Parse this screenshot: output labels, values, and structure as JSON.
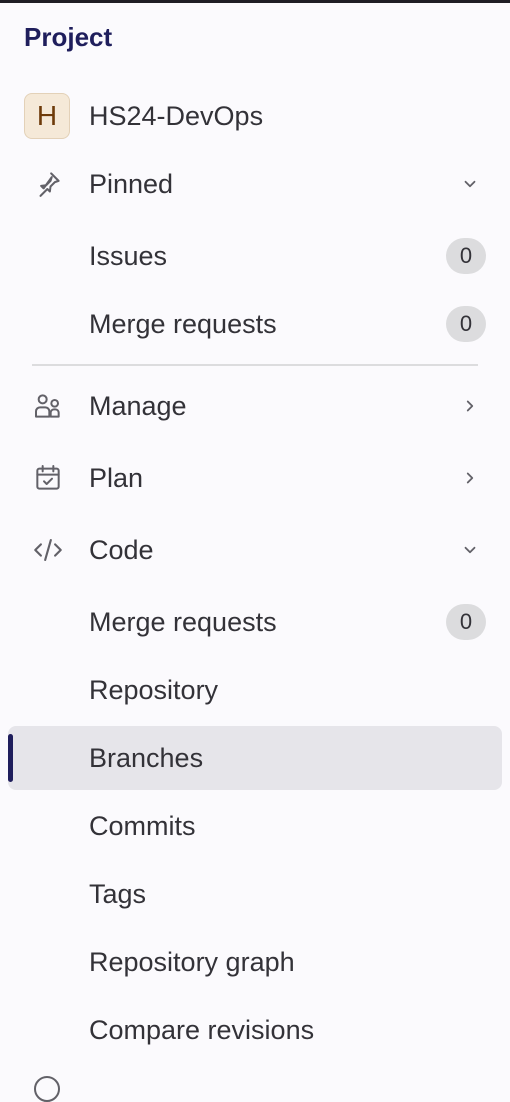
{
  "sidebar": {
    "heading": "Project",
    "project": {
      "avatar_letter": "H",
      "name": "HS24-DevOps"
    },
    "pinned": {
      "label": "Pinned",
      "icon": "thumbtack-icon",
      "items": [
        {
          "label": "Issues",
          "count": "0"
        },
        {
          "label": "Merge requests",
          "count": "0"
        }
      ]
    },
    "sections": [
      {
        "label": "Manage",
        "icon": "users-icon"
      },
      {
        "label": "Plan",
        "icon": "calendar-icon"
      },
      {
        "label": "Code",
        "icon": "code-icon"
      }
    ],
    "code_items": [
      {
        "label": "Merge requests",
        "count": "0"
      },
      {
        "label": "Repository"
      },
      {
        "label": "Branches",
        "active": true
      },
      {
        "label": "Commits"
      },
      {
        "label": "Tags"
      },
      {
        "label": "Repository graph"
      },
      {
        "label": "Compare revisions"
      }
    ]
  },
  "colors": {
    "accent": "#1f1e5c",
    "background": "#fbfafd",
    "active_background": "#e6e5ea",
    "badge_background": "#dcdcde",
    "avatar_background": "#f5e9d8"
  }
}
